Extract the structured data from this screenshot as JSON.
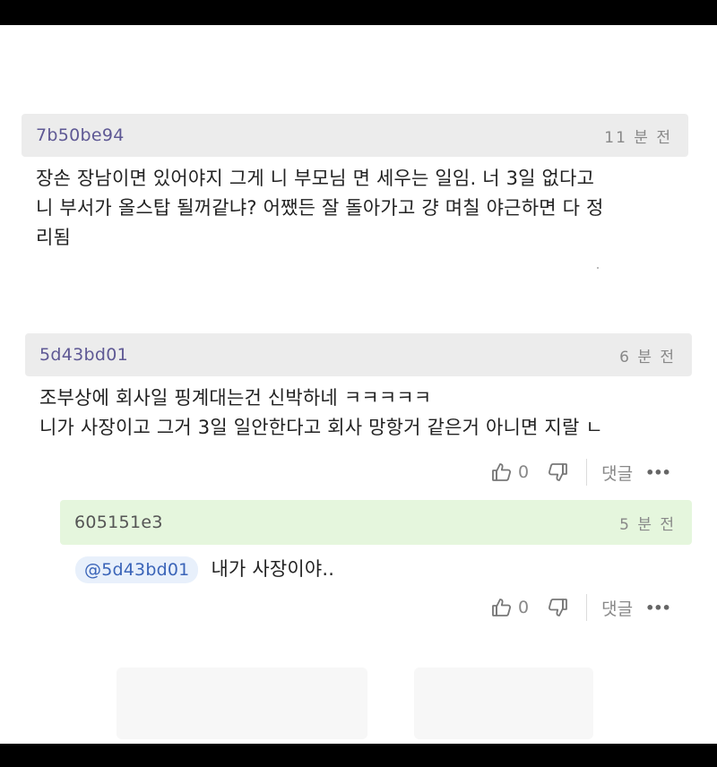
{
  "comments": [
    {
      "author": "7b50be94",
      "time": "11 분 전",
      "lines": [
        "장손 장남이면 있어야지 그게 니 부모님 면 세우는 일임. 너 3일 없다고",
        "니 부서가 올스탑 될꺼같냐? 어쨌든 잘 돌아가고 걍 며칠 야근하면 다 정",
        "리됨"
      ]
    },
    {
      "author": "5d43bd01",
      "time": "6 분 전",
      "lines": [
        "조부상에 회사일 핑계대는건 신박하네 ㅋㅋㅋㅋㅋ",
        "니가 사장이고 그거 3일 일안한다고 회사 망항거 같은거 아니면 지랄 ㄴ"
      ],
      "likes": "0",
      "reply_label": "댓글",
      "more": "•••"
    }
  ],
  "reply": {
    "author": "605151e3",
    "time": "5 분 전",
    "mention": "@5d43bd01",
    "text": "내가 사장이야..",
    "likes": "0",
    "reply_label": "댓글",
    "more": "•••"
  }
}
